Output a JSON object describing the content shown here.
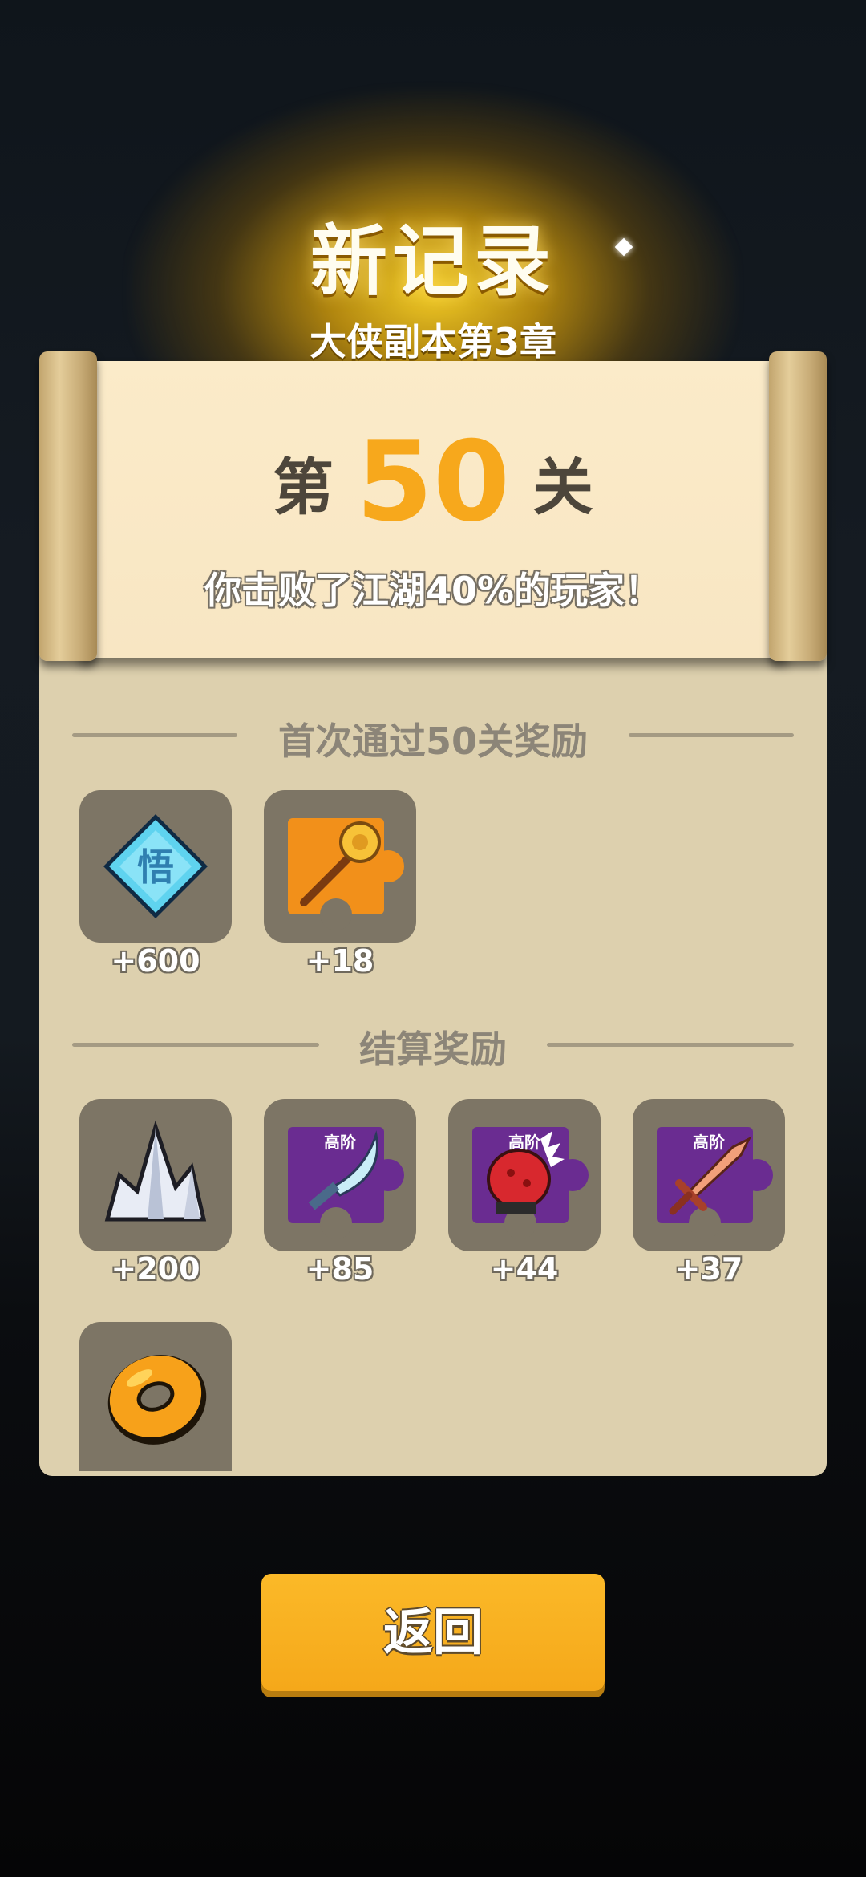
{
  "header": {
    "title": "新记录",
    "subtitle": "大侠副本第3章"
  },
  "scroll": {
    "level_prefix": "第",
    "level_number": "50",
    "level_suffix": "关",
    "beat_text": "你击败了江湖40%的玩家！"
  },
  "first_clear": {
    "title": "首次通过50关奖励",
    "items": [
      {
        "icon": "wu-gem-icon",
        "count": "+600"
      },
      {
        "icon": "golden-mace-puzzle-icon",
        "count": "+18"
      }
    ]
  },
  "settlement": {
    "title": "结算奖励",
    "items": [
      {
        "icon": "crystal-icon",
        "count": "+200",
        "tier": ""
      },
      {
        "icon": "blade-puzzle-icon",
        "count": "+85",
        "tier": "高阶"
      },
      {
        "icon": "gauntlet-puzzle-icon",
        "count": "+44",
        "tier": "高阶"
      },
      {
        "icon": "sword-puzzle-icon",
        "count": "+37",
        "tier": "高阶"
      },
      {
        "icon": "gold-coin-icon",
        "count": "",
        "tier": ""
      }
    ]
  },
  "buttons": {
    "back": "返回"
  },
  "colors": {
    "accent": "#f7a81c",
    "panel": "#ddd0ae",
    "slot": "#7d7565",
    "puzzle_purple": "#6a2c91"
  }
}
